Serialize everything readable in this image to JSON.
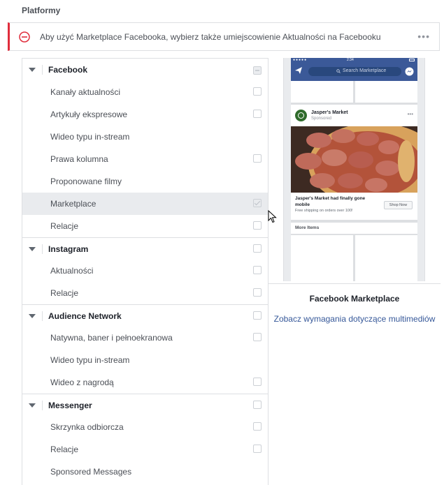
{
  "section_title": "Platformy",
  "error": {
    "message": "Aby użyć Marketplace Facebooka, wybierz także umiejscowienie Aktualności na Facebooku",
    "status_color": "#e02d3c"
  },
  "groups": [
    {
      "label": "Facebook",
      "state": "partial",
      "items": [
        {
          "label": "Kanały aktualności",
          "checkbox": true,
          "checked": false
        },
        {
          "label": "Artykuły ekspresowe",
          "checkbox": true,
          "checked": false
        },
        {
          "label": "Wideo typu in-stream",
          "checkbox": false,
          "checked": false
        },
        {
          "label": "Prawa kolumna",
          "checkbox": true,
          "checked": false
        },
        {
          "label": "Proponowane filmy",
          "checkbox": false,
          "checked": false
        },
        {
          "label": "Marketplace",
          "checkbox": true,
          "checked": true,
          "selected": true
        },
        {
          "label": "Relacje",
          "checkbox": true,
          "checked": false
        }
      ]
    },
    {
      "label": "Instagram",
      "state": "unchecked",
      "items": [
        {
          "label": "Aktualności",
          "checkbox": true,
          "checked": false
        },
        {
          "label": "Relacje",
          "checkbox": true,
          "checked": false
        }
      ]
    },
    {
      "label": "Audience Network",
      "state": "unchecked",
      "items": [
        {
          "label": "Natywna, baner i pełnoekranowa",
          "checkbox": true,
          "checked": false
        },
        {
          "label": "Wideo typu in-stream",
          "checkbox": false,
          "checked": false
        },
        {
          "label": "Wideo z nagrodą",
          "checkbox": true,
          "checked": false
        }
      ]
    },
    {
      "label": "Messenger",
      "state": "unchecked",
      "items": [
        {
          "label": "Skrzynka odbiorcza",
          "checkbox": true,
          "checked": false
        },
        {
          "label": "Relacje",
          "checkbox": true,
          "checked": false
        },
        {
          "label": "Sponsored Messages",
          "checkbox": false,
          "checked": false
        }
      ]
    }
  ],
  "preview": {
    "status_time": "2:34",
    "search_placeholder": "Search Marketplace",
    "post_brand": "Jasper's Market",
    "post_sponsored": "Sponsored",
    "post_headline": "Jasper's Market had finally gone mobile",
    "post_description": "Free shipping on orders over 100!",
    "cta_label": "Shop Now",
    "more_items": "More Items",
    "brand_color": "#3b5998"
  },
  "placement_title": "Facebook Marketplace",
  "media_link": "Zobacz wymagania dotyczące multimediów"
}
